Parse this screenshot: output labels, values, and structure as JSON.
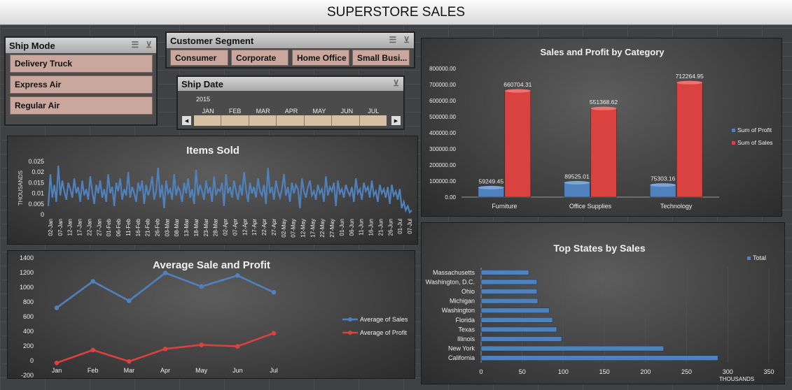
{
  "header": {
    "title": "SUPERSTORE SALES"
  },
  "slicers": {
    "ship_mode": {
      "title": "Ship Mode",
      "options": [
        "Delivery Truck",
        "Express Air",
        "Regular Air"
      ]
    },
    "customer_segment": {
      "title": "Customer Segment",
      "options": [
        "Consumer",
        "Corporate",
        "Home Office",
        "Small Busi..."
      ]
    },
    "ship_date": {
      "title": "Ship Date",
      "year": "2015",
      "months": [
        "JAN",
        "FEB",
        "MAR",
        "APR",
        "MAY",
        "JUN",
        "JUL"
      ],
      "scroll_left": "◀",
      "scroll_right": "▶"
    }
  },
  "icons": {
    "multiselect": "multi-select-icon",
    "clear_filter": "clear-filter-icon"
  },
  "colors": {
    "blue": "#4f81bd",
    "red": "#d9423f",
    "background": "#3f4143"
  },
  "chart_data": [
    {
      "id": "items_sold",
      "type": "line",
      "title": "Items Sold",
      "ylabel": "THOUSANDS",
      "ylim": [
        0,
        0.025
      ],
      "y_ticks": [
        "0",
        "0.005",
        "0.01",
        "0.015",
        "0.02",
        "0.025"
      ],
      "x_tick_labels": [
        "02-Jan",
        "07-Jan",
        "12-Jan",
        "17-Jan",
        "22-Jan",
        "27-Jan",
        "01-Feb",
        "06-Feb",
        "11-Feb",
        "16-Feb",
        "21-Feb",
        "26-Feb",
        "03-Mar",
        "08-Mar",
        "13-Mar",
        "18-Mar",
        "23-Mar",
        "28-Mar",
        "02-Apr",
        "07-Apr",
        "12-Apr",
        "17-Apr",
        "22-Apr",
        "27-Apr",
        "02-May",
        "07-May",
        "12-May",
        "17-May",
        "22-May",
        "27-May",
        "01-Jun",
        "06-Jun",
        "11-Jun",
        "16-Jun",
        "21-Jun",
        "26-Jun",
        "01-Jul",
        "07-Jul"
      ],
      "values": [
        0.004,
        0.019,
        0.008,
        0.014,
        0.006,
        0.023,
        0.009,
        0.016,
        0.011,
        0.007,
        0.015,
        0.012,
        0.008,
        0.017,
        0.01,
        0.013,
        0.006,
        0.016,
        0.009,
        0.012,
        0.007,
        0.018,
        0.011,
        0.005,
        0.014,
        0.01,
        0.016,
        0.008,
        0.012,
        0.006,
        0.019,
        0.01,
        0.013,
        0.004,
        0.015,
        0.011,
        0.017,
        0.007,
        0.012,
        0.009,
        0.02,
        0.008,
        0.013,
        0.01,
        0.006,
        0.015,
        0.011,
        0.016,
        0.005,
        0.014,
        0.009,
        0.012,
        0.018,
        0.007,
        0.011,
        0.022,
        0.008,
        0.014,
        0.003,
        0.016,
        0.01,
        0.012,
        0.007,
        0.019,
        0.009,
        0.013,
        0.011,
        0.006,
        0.015,
        0.01,
        0.017,
        0.008,
        0.012,
        0.005,
        0.021,
        0.009,
        0.014,
        0.011,
        0.007,
        0.016,
        0.01,
        0.013,
        0.006,
        0.018,
        0.009,
        0.012,
        0.011,
        0.015,
        0.004,
        0.019,
        0.01,
        0.013,
        0.008,
        0.016,
        0.011,
        0.007,
        0.014,
        0.009,
        0.02,
        0.012,
        0.006,
        0.015,
        0.01,
        0.013,
        0.008,
        0.017,
        0.011,
        0.009,
        0.014,
        0.005,
        0.022,
        0.01,
        0.013,
        0.007,
        0.016,
        0.011,
        0.008,
        0.012,
        0.019,
        0.009,
        0.013,
        0.006,
        0.015,
        0.01,
        0.014,
        0.012,
        0.003,
        0.017,
        0.011,
        0.008,
        0.013,
        0.016,
        0.009,
        0.011,
        0.007,
        0.014,
        0.01,
        0.012,
        0.006,
        0.018,
        0.009,
        0.013,
        0.011,
        0.015,
        0.004,
        0.016,
        0.01,
        0.012,
        0.008,
        0.014,
        0.011,
        0.009,
        0.013,
        0.006,
        0.017,
        0.01,
        0.012,
        0.007,
        0.015,
        0.011,
        0.013,
        0.008,
        0.016,
        0.009,
        0.011,
        0.006,
        0.014,
        0.01,
        0.012,
        0.008,
        0.013,
        0.005,
        0.014,
        0.009,
        0.011,
        0.007,
        0.012,
        0.003,
        0.006,
        0.002,
        0.004,
        0.001,
        0.002
      ]
    },
    {
      "id": "sales_profit_category",
      "type": "bar",
      "title": "Sales and Profit by Category",
      "categories": [
        "Furniture",
        "Office Supplies",
        "Technology"
      ],
      "series": [
        {
          "name": "Sum of Profit",
          "values": [
            59249.45,
            89525.01,
            75303.16
          ],
          "labels": [
            "59249.45",
            "89525.01",
            "75303.16"
          ]
        },
        {
          "name": "Sum of Sales",
          "values": [
            660704.31,
            551368.62,
            712264.95
          ],
          "labels": [
            "660704.31",
            "551368.62",
            "712264.95"
          ]
        }
      ],
      "ylim": [
        0,
        800000
      ],
      "y_ticks": [
        "0.00",
        "100000.00",
        "200000.00",
        "300000.00",
        "400000.00",
        "500000.00",
        "600000.00",
        "700000.00",
        "800000.00"
      ],
      "legend": "right"
    },
    {
      "id": "avg_sale_profit",
      "type": "line",
      "title": "Average Sale and Profit",
      "categories": [
        "Jan",
        "Feb",
        "Mar",
        "Apr",
        "May",
        "Jun",
        "Jul"
      ],
      "series": [
        {
          "name": "Average of Sales",
          "values": [
            720,
            1080,
            815,
            1195,
            1010,
            1160,
            930
          ]
        },
        {
          "name": "Average of Profit",
          "values": [
            -30,
            145,
            -10,
            160,
            215,
            195,
            375
          ]
        }
      ],
      "ylim": [
        -200,
        1400
      ],
      "y_ticks": [
        "-200",
        "0",
        "200",
        "400",
        "600",
        "800",
        "1000",
        "1200",
        "1400"
      ],
      "legend": "right"
    },
    {
      "id": "top_states",
      "type": "bar",
      "title": "Top States by Sales",
      "categories": [
        "Massachusetts",
        "Washington, D.C.",
        "Ohio",
        "Michigan",
        "Washington",
        "Florida",
        "Texas",
        "Illinois",
        "New York",
        "California"
      ],
      "series": [
        {
          "name": "Total",
          "values": [
            58,
            68,
            68,
            69,
            83,
            87,
            92,
            98,
            222,
            288
          ]
        }
      ],
      "xlim": [
        0,
        350
      ],
      "x_ticks": [
        "0",
        "50",
        "100",
        "150",
        "200",
        "250",
        "300",
        "350"
      ],
      "xlabel": "THOUSANDS",
      "legend": "top-right"
    }
  ]
}
